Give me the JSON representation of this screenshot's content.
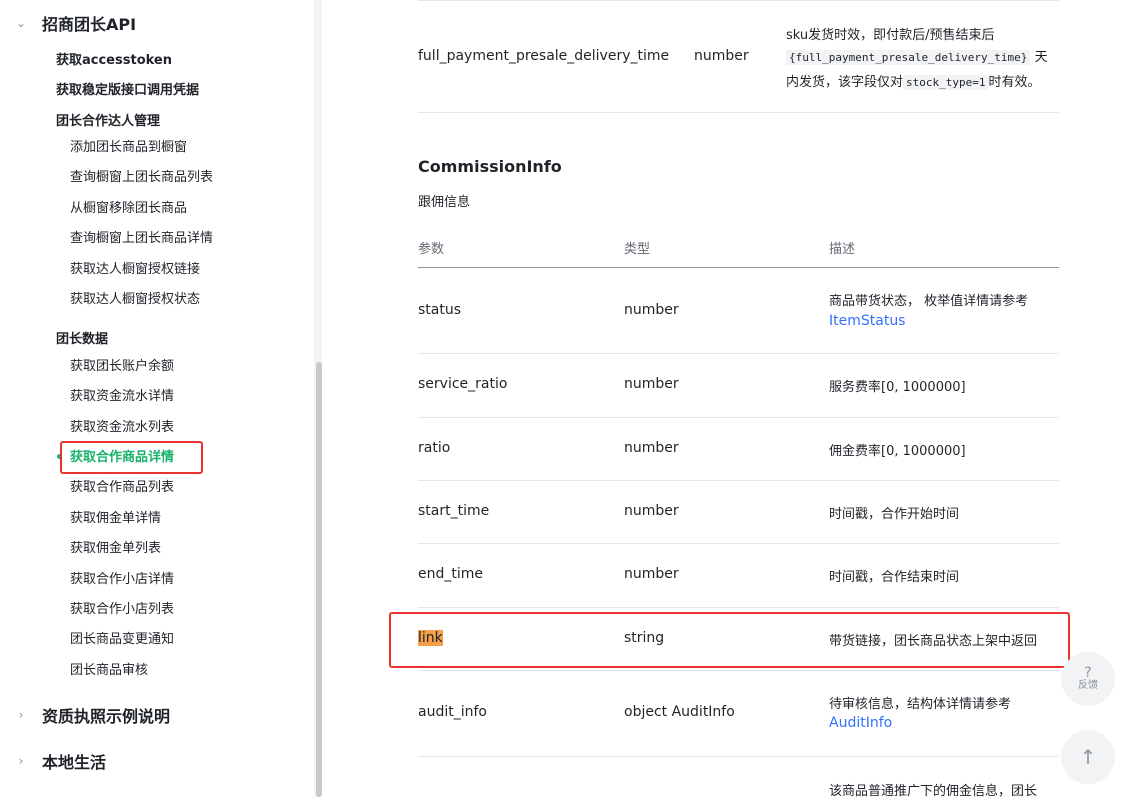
{
  "sidebar": {
    "group1": {
      "title": "招商团长API",
      "chevron": "chevron-down-icon"
    },
    "top_items": [
      "获取accesstoken",
      "获取稳定版接口调用凭据"
    ],
    "section1": {
      "title": "团长合作达人管理",
      "items": [
        "添加团长商品到橱窗",
        "查询橱窗上团长商品列表",
        "从橱窗移除团长商品",
        "查询橱窗上团长商品详情",
        "获取达人橱窗授权链接",
        "获取达人橱窗授权状态"
      ]
    },
    "section2": {
      "title": "团长数据",
      "items": [
        "获取团长账户余额",
        "获取资金流水详情",
        "获取资金流水列表",
        "获取合作商品详情",
        "获取合作商品列表",
        "获取佣金单详情",
        "获取佣金单列表",
        "获取合作小店详情",
        "获取合作小店列表",
        "团长商品变更通知",
        "团长商品审核"
      ],
      "active_index": 3
    },
    "group2": {
      "title": "资质执照示例说明",
      "chevron": "chevron-right-icon"
    },
    "group3": {
      "title": "本地生活",
      "chevron": "chevron-right-icon"
    }
  },
  "top_row": {
    "name": "full_payment_presale_delivery_time",
    "type": "number",
    "desc_l1": "sku发货时效，即付款后/预售结束后",
    "desc_code1": "{full_payment_presale_delivery_time}",
    "desc_l2_tail": "天",
    "desc_l3_head": "内发货，该字段仅对",
    "desc_code2": "stock_type=1",
    "desc_l3_tail": "时有效。"
  },
  "section": {
    "title": "CommissionInfo",
    "subtitle": "跟佣信息",
    "headers": [
      "参数",
      "类型",
      "描述"
    ],
    "rows": [
      {
        "name": "status",
        "type": "number",
        "desc": "商品带货状态， 枚举值详情请参考",
        "link": "ItemStatus"
      },
      {
        "name": "service_ratio",
        "type": "number",
        "desc": "服务费率[0, 1000000]"
      },
      {
        "name": "ratio",
        "type": "number",
        "desc": "佣金费率[0, 1000000]"
      },
      {
        "name": "start_time",
        "type": "number",
        "desc": "时间戳，合作开始时间"
      },
      {
        "name": "end_time",
        "type": "number",
        "desc": "时间戳，合作结束时间"
      },
      {
        "name": "link",
        "type": "string",
        "desc": "带货链接，团长商品状态上架中返回"
      },
      {
        "name": "audit_info",
        "type": "object AuditInfo",
        "desc": "待审核信息，结构体详情请参考",
        "link": "AuditInfo"
      },
      {
        "name": "",
        "type": "",
        "desc": "该商品普通推广下的佣金信息，团长"
      }
    ]
  },
  "floating": {
    "feedback_mark": "?",
    "feedback_label": "反馈",
    "feedback_icon": "question-icon",
    "top_icon": "arrow-up-icon",
    "top_glyph": "↑"
  }
}
